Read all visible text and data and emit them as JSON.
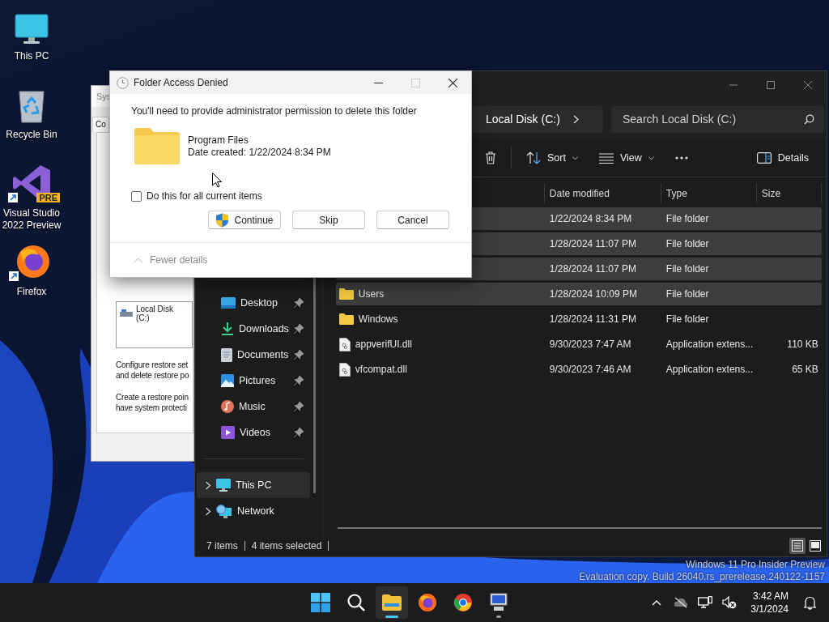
{
  "desktop_icons": [
    {
      "kind": "pc",
      "label": "This PC",
      "shortcut": false
    },
    {
      "kind": "bin",
      "label": "Recycle Bin",
      "shortcut": false
    },
    {
      "kind": "vs",
      "label": "Visual Studio 2022 Preview",
      "shortcut": true,
      "badge": "PRE"
    },
    {
      "kind": "firefox",
      "label": "Firefox",
      "shortcut": true
    }
  ],
  "background_window": {
    "title": "Sys",
    "tab": "Co",
    "drive": "Local Disk (C:)",
    "paragraphs": [
      [
        "Configure restore set",
        "and delete restore po"
      ],
      [
        "Create a restore poin",
        "have system protecti"
      ]
    ]
  },
  "dialog": {
    "title": "Folder Access Denied",
    "window_buttons": [
      {
        "kind": "minimize",
        "disabled": false
      },
      {
        "kind": "maximize",
        "disabled": true
      },
      {
        "kind": "close",
        "disabled": false
      }
    ],
    "message": "You'll need to provide administrator permission to delete this folder",
    "item_name": "Program Files",
    "item_date": "Date created: 1/22/2024 8:34 PM",
    "checkbox": {
      "label": "Do this for all current items",
      "checked": false
    },
    "buttons": [
      {
        "label": "Continue",
        "kind": "shield"
      },
      {
        "label": "Skip",
        "kind": "plain"
      },
      {
        "label": "Cancel",
        "kind": "plain"
      }
    ],
    "details_toggle": "Fewer details"
  },
  "explorer": {
    "address": "Local Disk (C:)",
    "search_placeholder": "Search Local Disk (C:)",
    "toolbar": {
      "sort": "Sort",
      "view": "View",
      "details": "Details"
    },
    "columns": [
      "Date modified",
      "Type",
      "Size"
    ],
    "rows": [
      {
        "date": "1/22/2024 8:34 PM",
        "type": "File folder",
        "size": "",
        "selected": true
      },
      {
        "date": "1/28/2024 11:07 PM",
        "type": "File folder",
        "size": "",
        "selected": true
      },
      {
        "date": "1/28/2024 11:07 PM",
        "type": "File folder",
        "size": "",
        "selected": true
      },
      {
        "kind": "folder",
        "name": "Users",
        "date": "1/28/2024 10:09 PM",
        "type": "File folder",
        "size": "",
        "selected": true
      },
      {
        "kind": "folder",
        "name": "Windows",
        "date": "1/28/2024 11:31 PM",
        "type": "File folder",
        "size": "",
        "selected": false
      },
      {
        "kind": "file",
        "name": "appverifUI.dll",
        "date": "9/30/2023 7:47 AM",
        "type": "Application extens...",
        "size": "110 KB",
        "selected": false
      },
      {
        "kind": "file",
        "name": "vfcompat.dll",
        "date": "9/30/2023 7:46 AM",
        "type": "Application extens...",
        "size": "65 KB",
        "selected": false
      }
    ],
    "quick_access": [
      {
        "kind": "desktop",
        "label": "Desktop",
        "pinned": true
      },
      {
        "kind": "downloads",
        "label": "Downloads",
        "pinned": true
      },
      {
        "kind": "documents",
        "label": "Documents",
        "pinned": true
      },
      {
        "kind": "pictures",
        "label": "Pictures",
        "pinned": true
      },
      {
        "kind": "music",
        "label": "Music",
        "pinned": true
      },
      {
        "kind": "videos",
        "label": "Videos",
        "pinned": true
      }
    ],
    "locations": [
      {
        "kind": "pc",
        "label": "This PC",
        "selected": true
      },
      {
        "kind": "network",
        "label": "Network",
        "selected": false
      }
    ],
    "status": [
      "7 items",
      "4 items selected"
    ],
    "view_modes": [
      {
        "kind": "details",
        "selected": true
      },
      {
        "kind": "tiles",
        "selected": false
      }
    ]
  },
  "os_watermark": [
    "Windows 11 Pro Insider Preview",
    "Evaluation copy. Build 26040.rs_prerelease.240122-1157"
  ],
  "taskbar": {
    "apps": [
      {
        "kind": "start",
        "running": false,
        "active": false
      },
      {
        "kind": "search",
        "running": false,
        "active": false
      },
      {
        "kind": "explorer",
        "running": true,
        "active": true
      },
      {
        "kind": "firefox",
        "running": false,
        "active": false
      },
      {
        "kind": "chrome",
        "running": false,
        "active": false
      },
      {
        "kind": "remote",
        "running": true,
        "active": false
      }
    ],
    "time": "3:42 AM",
    "date": "3/1/2024"
  }
}
